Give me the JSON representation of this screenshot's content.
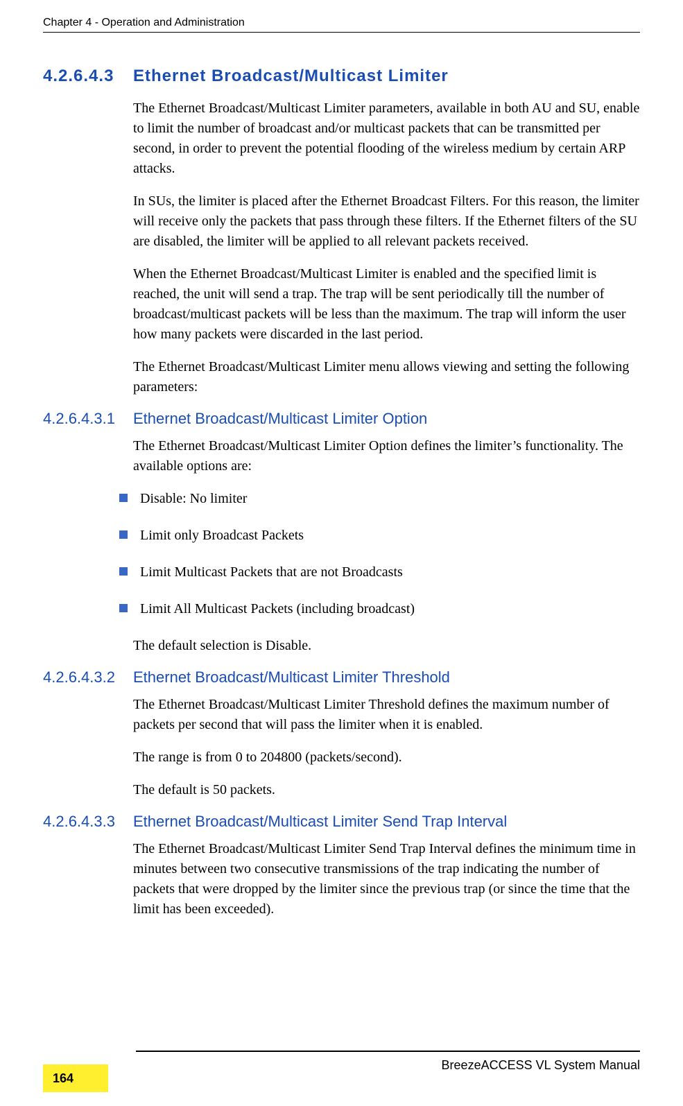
{
  "header": {
    "chapter": "Chapter 4 - Operation and Administration"
  },
  "section": {
    "num": "4.2.6.4.3",
    "title": "Ethernet Broadcast/Multicast Limiter",
    "p1": "The Ethernet Broadcast/Multicast Limiter parameters, available in both AU and SU, enable to limit the number of broadcast and/or multicast packets that can be transmitted per second, in order to prevent the potential flooding of the wireless medium by certain ARP attacks.",
    "p2": "In SUs, the limiter is placed after the Ethernet Broadcast Filters. For this reason, the limiter will receive only the packets that pass through these filters. If the Ethernet filters of the SU are disabled, the limiter will be applied to all relevant packets received.",
    "p3": "When the Ethernet Broadcast/Multicast Limiter is enabled and the specified limit is reached, the unit will send a trap. The trap will be sent periodically till the number of broadcast/multicast packets will be less than the maximum. The trap will inform the user how many packets were discarded in the last period.",
    "p4": "The Ethernet Broadcast/Multicast Limiter menu allows viewing and setting the following parameters:"
  },
  "sub1": {
    "num": "4.2.6.4.3.1",
    "title": "Ethernet Broadcast/Multicast Limiter Option",
    "intro": "The Ethernet Broadcast/Multicast Limiter Option defines the limiter’s functionality. The available options are:",
    "bullets": [
      "Disable: No limiter",
      "Limit only Broadcast Packets",
      "Limit Multicast Packets that are not Broadcasts",
      "Limit All Multicast Packets (including broadcast)"
    ],
    "outro": "The default selection is Disable."
  },
  "sub2": {
    "num": "4.2.6.4.3.2",
    "title": "Ethernet Broadcast/Multicast Limiter Threshold",
    "p1": "The Ethernet Broadcast/Multicast Limiter Threshold defines the maximum number of packets per second that will pass the limiter when it is enabled.",
    "p2": "The range is from 0 to 204800 (packets/second).",
    "p3": "The default is 50 packets."
  },
  "sub3": {
    "num": "4.2.6.4.3.3",
    "title": "Ethernet Broadcast/Multicast Limiter Send Trap Interval",
    "p1": "The Ethernet Broadcast/Multicast Limiter Send Trap Interval defines the minimum time in minutes between two consecutive transmissions of the trap indicating the number of packets that were dropped by the limiter since the previous trap (or since the time that the limit has been exceeded)."
  },
  "footer": {
    "manual": "BreezeACCESS VL System Manual",
    "page": "164"
  }
}
